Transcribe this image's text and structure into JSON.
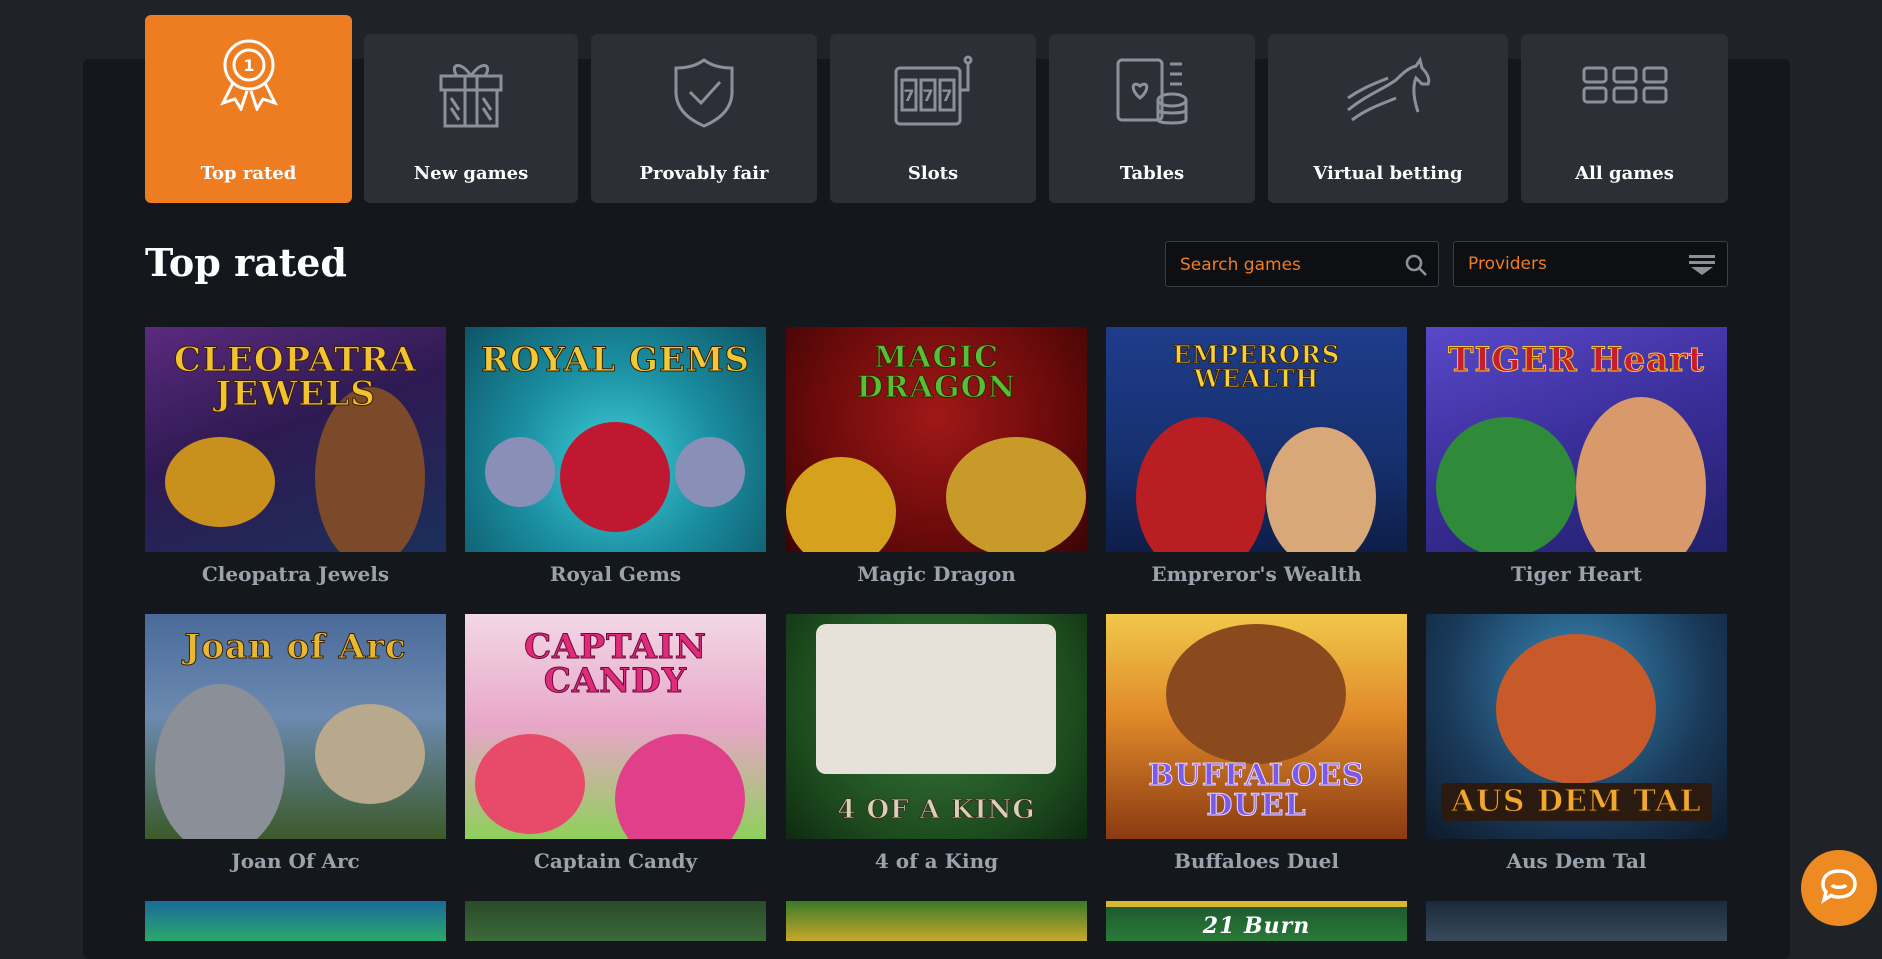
{
  "categories": [
    {
      "label": "Top rated",
      "icon": "award-ribbon-icon",
      "active": true
    },
    {
      "label": "New games",
      "icon": "gift-icon",
      "active": false
    },
    {
      "label": "Provably fair",
      "icon": "shield-check-icon",
      "active": false
    },
    {
      "label": "Slots",
      "icon": "slot-machine-icon",
      "active": false
    },
    {
      "label": "Tables",
      "icon": "cards-chips-icon",
      "active": false
    },
    {
      "label": "Virtual betting",
      "icon": "horse-icon",
      "active": false
    },
    {
      "label": "All games",
      "icon": "grid-icon",
      "active": false
    }
  ],
  "section_title": "Top rated",
  "search": {
    "placeholder": "Search games",
    "icon": "search-icon"
  },
  "providers": {
    "label": "Providers",
    "icon": "filter-list-icon"
  },
  "games": [
    {
      "name": "Cleopatra Jewels",
      "logo": "CLEOPATRA JEWELS"
    },
    {
      "name": "Royal Gems",
      "logo": "ROYAL GEMS"
    },
    {
      "name": "Magic Dragon",
      "logo": "MAGIC DRAGON"
    },
    {
      "name": "Empreror's Wealth",
      "logo": "EMPERORS WEALTH"
    },
    {
      "name": "Tiger Heart",
      "logo": "TIGER Heart"
    },
    {
      "name": "Joan Of Arc",
      "logo": "Joan of Arc"
    },
    {
      "name": "Captain Candy",
      "logo": "CAPTAIN CANDY"
    },
    {
      "name": "4 of a King",
      "logo": "4 OF A KING"
    },
    {
      "name": "Buffaloes Duel",
      "logo": "BUFFALOES DUEL"
    },
    {
      "name": "Aus Dem Tal",
      "logo": "AUS DEM TAL"
    }
  ],
  "partial_row_logos": [
    "",
    "",
    "",
    "21 Burn",
    ""
  ],
  "chat": {
    "icon": "chat-bubble-icon"
  },
  "colors": {
    "accent": "#ee7d22",
    "panel": "#14171b",
    "tile": "#2c2f35"
  }
}
